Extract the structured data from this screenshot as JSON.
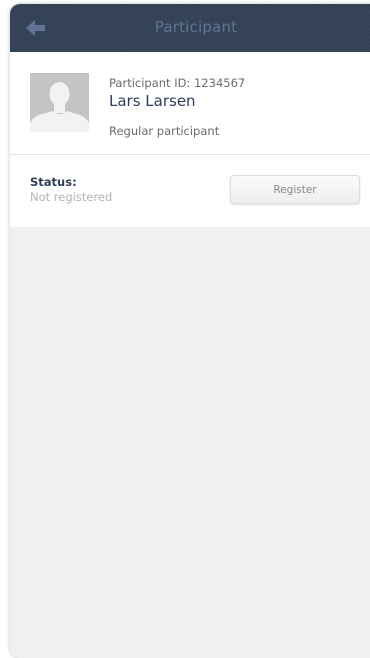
{
  "header": {
    "title": "Participant",
    "back_icon": "arrow-left-icon"
  },
  "profile": {
    "avatar_icon": "user-silhouette-icon",
    "participant_id": "Participant ID: 1234567",
    "name": "Lars Larsen",
    "type": "Regular participant"
  },
  "status": {
    "label": "Status:",
    "value": "Not registered",
    "register_label": "Register"
  },
  "colors": {
    "header_bg": "#334155",
    "name_text": "#2e3e58",
    "page_bg": "#eff0f2"
  }
}
